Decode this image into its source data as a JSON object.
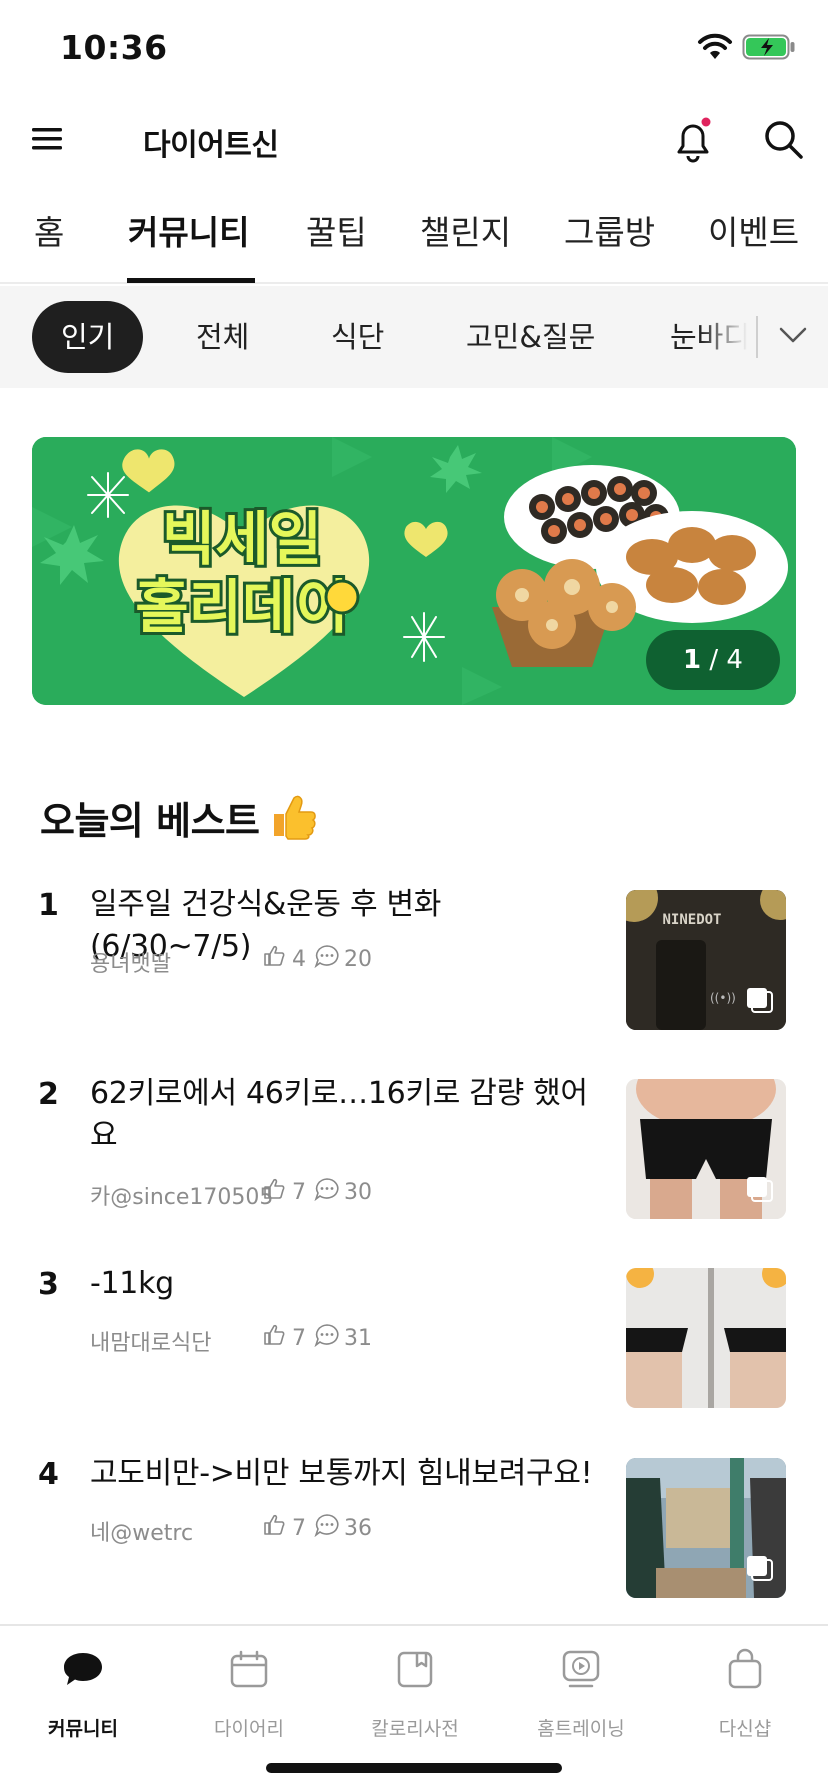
{
  "status_bar": {
    "time": "10:36"
  },
  "header": {
    "title": "다이어트신"
  },
  "main_tabs": [
    {
      "label": "홈"
    },
    {
      "label": "커뮤니티",
      "active": true
    },
    {
      "label": "꿀팁"
    },
    {
      "label": "챌린지"
    },
    {
      "label": "그룹방"
    },
    {
      "label": "이벤트"
    }
  ],
  "sub_filters": [
    {
      "label": "인기",
      "active": true
    },
    {
      "label": "전체"
    },
    {
      "label": "식단"
    },
    {
      "label": "고민&질문"
    },
    {
      "label": "눈바디"
    }
  ],
  "banner": {
    "line1": "빅세일",
    "line2": "홀리데이",
    "pager_current": "1",
    "pager_total": "4"
  },
  "best": {
    "title": "오늘의 베스트",
    "posts": [
      {
        "rank": "1",
        "title": "일주일 건강식&운동 후 변화(6/30~7/5)",
        "author": "용녀뱃딸",
        "likes": "4",
        "comments": "20",
        "thumb_text": "NINEDOT"
      },
      {
        "rank": "2",
        "title": "62키로에서 46키로…16키로 감량 했어요",
        "author": "카@since170505",
        "likes": "7",
        "comments": "30"
      },
      {
        "rank": "3",
        "title": "-11kg",
        "author": "내맘대로식단",
        "likes": "7",
        "comments": "31"
      },
      {
        "rank": "4",
        "title": "고도비만->비만 보통까지 힘내보려구요!",
        "author": "네@wetrc",
        "likes": "7",
        "comments": "36"
      }
    ]
  },
  "bottom_nav": [
    {
      "label": "커뮤니티",
      "icon": "chat-bubble-icon",
      "active": true
    },
    {
      "label": "다이어리",
      "icon": "calendar-icon"
    },
    {
      "label": "칼로리사전",
      "icon": "book-icon"
    },
    {
      "label": "홈트레이닝",
      "icon": "play-video-icon"
    },
    {
      "label": "다신샵",
      "icon": "shopping-bag-icon"
    }
  ],
  "colors": {
    "accent_dot": "#e0245e",
    "banner_green": "#2aac5b",
    "active_chip": "#1f1f1f"
  }
}
